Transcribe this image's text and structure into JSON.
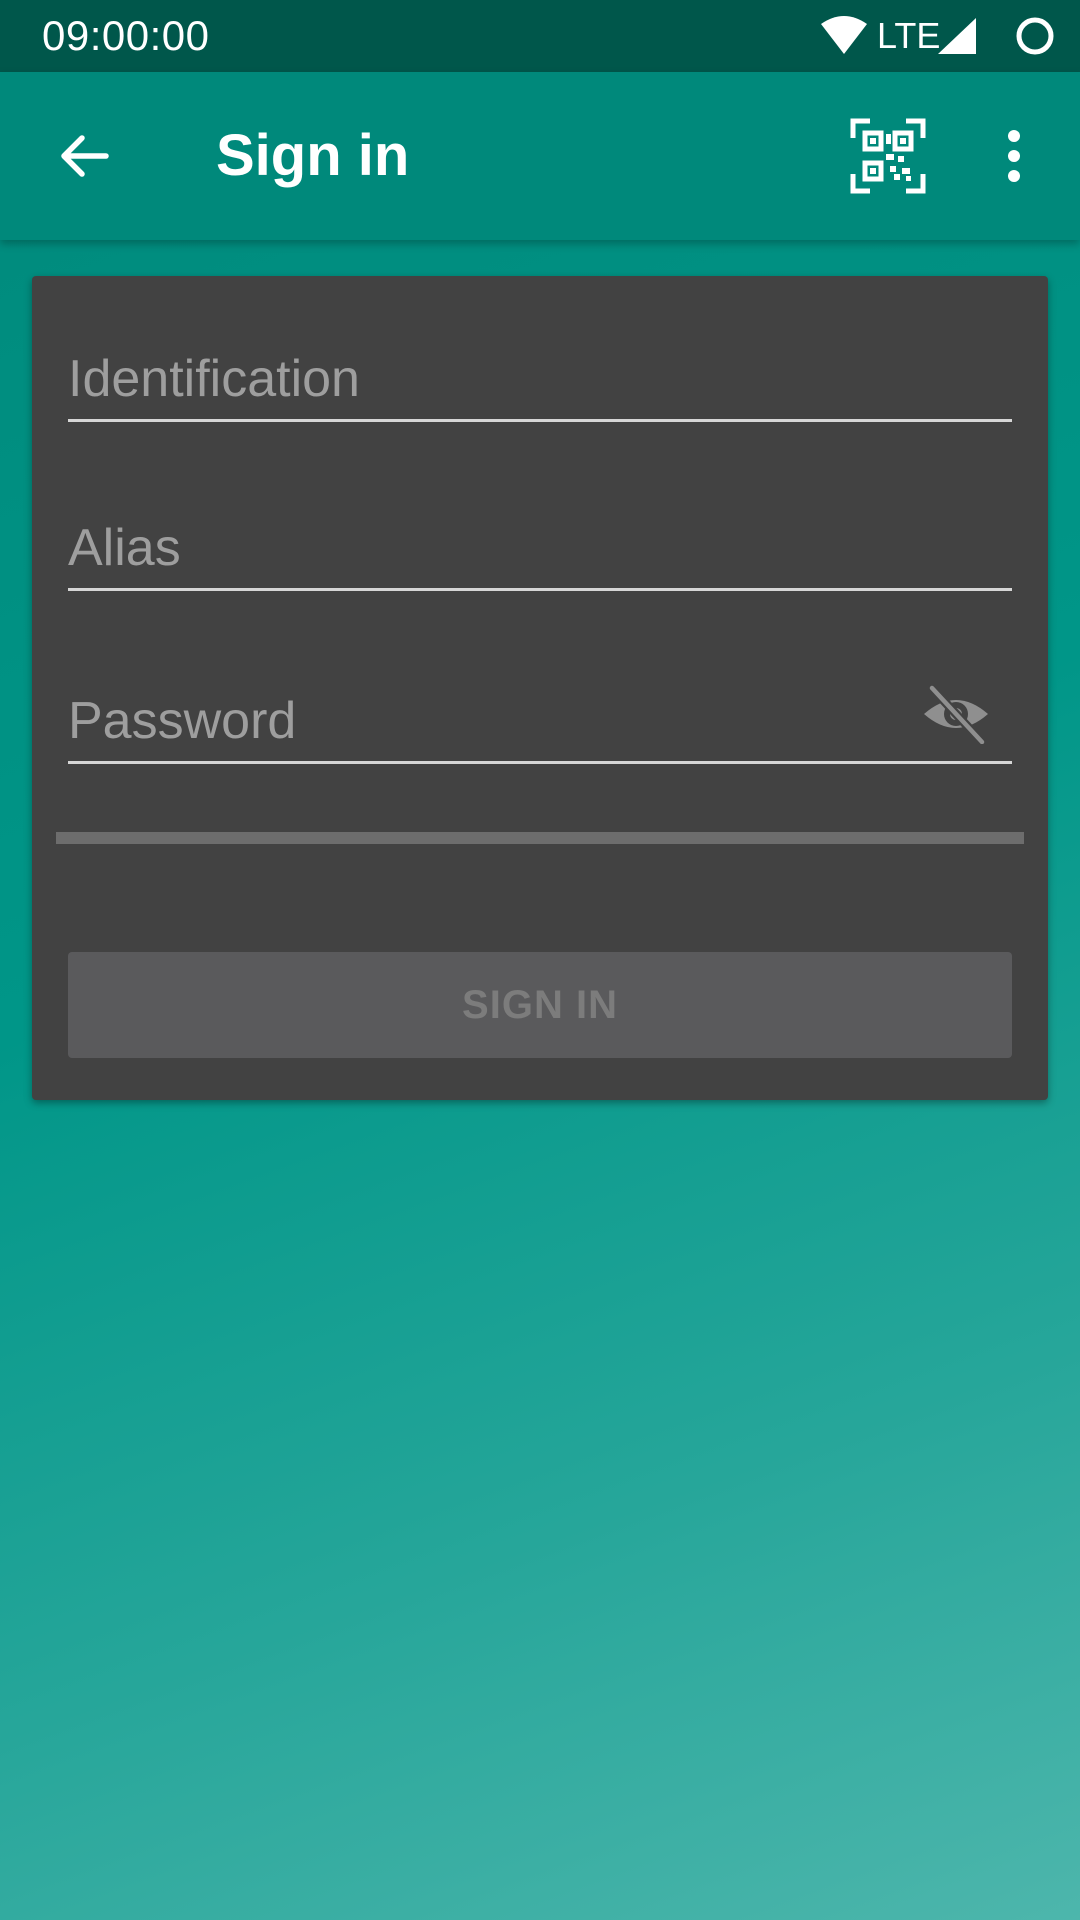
{
  "status_bar": {
    "time": "09:00:00",
    "network_label": "LTE",
    "icons": [
      "wifi-icon",
      "signal-icon",
      "battery-icon"
    ]
  },
  "app_bar": {
    "title": "Sign in",
    "icons": [
      "back-arrow-icon",
      "qr-code-icon",
      "more-vert-icon"
    ]
  },
  "form": {
    "identification": {
      "placeholder": "Identification",
      "value": ""
    },
    "alias": {
      "placeholder": "Alias",
      "value": ""
    },
    "password": {
      "placeholder": "Password",
      "value": "",
      "toggle_icon": "visibility-off-icon"
    },
    "progress": 0,
    "submit_label": "SIGN IN",
    "submit_enabled": false
  },
  "colors": {
    "status_bar": "#00574b",
    "primary": "#00897b",
    "card": "#424242",
    "button_disabled": "#5a5a5c"
  }
}
